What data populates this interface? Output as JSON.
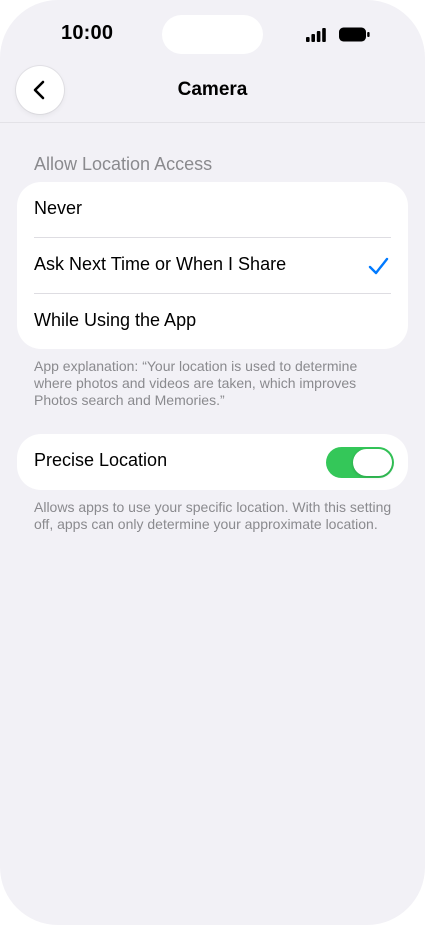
{
  "status_bar": {
    "time": "10:00",
    "icons": [
      "cellular-signal-icon",
      "battery-icon"
    ]
  },
  "nav": {
    "back_icon": "chevron-left-icon",
    "title": "Camera"
  },
  "location_access": {
    "header": "Allow Location Access",
    "options": [
      {
        "label": "Never",
        "selected": false
      },
      {
        "label": "Ask Next Time or When I Share",
        "selected": true
      },
      {
        "label": "While Using the App",
        "selected": false
      }
    ],
    "explanation": "App explanation: “Your location is used to determine where photos and videos are taken, which improves Photos search and Memories.”"
  },
  "precise_location": {
    "label": "Precise Location",
    "enabled": true,
    "footnote": "Allows apps to use your specific location. With this setting off, apps can only determine your approximate location."
  },
  "colors": {
    "accent": "#007aff",
    "toggle_on": "#34c759",
    "background": "#f2f1f6",
    "secondary_text": "#8a8a8e"
  }
}
